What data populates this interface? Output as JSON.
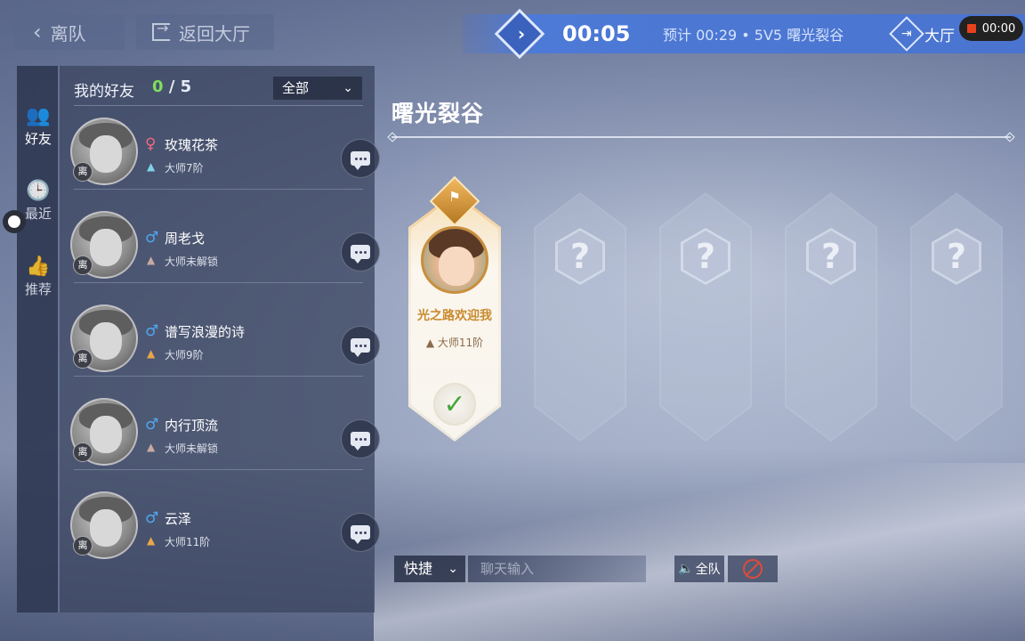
{
  "top": {
    "leave_label": "离队",
    "lobby_label": "返回大厅",
    "timer": "00:05",
    "estimate": "预计 00:29 • 5V5 曙光裂谷",
    "hall_label": "大厅",
    "recording_time": "00:00"
  },
  "side_tabs": [
    {
      "label": "好友",
      "icon": "friends-icon"
    },
    {
      "label": "最近",
      "icon": "clock-icon"
    },
    {
      "label": "推荐",
      "icon": "thumbs-up-icon"
    }
  ],
  "friends_panel": {
    "title": "我的好友",
    "online": "0",
    "total": "/ 5",
    "filter": "全部",
    "status_label": "离",
    "friends": [
      {
        "name": "玫瑰花茶",
        "gender": "female",
        "gender_symbol": "♀",
        "rank": "大师7阶"
      },
      {
        "name": "周老戈",
        "gender": "male",
        "gender_symbol": "♂",
        "rank": "大师未解锁"
      },
      {
        "name": "谱写浪漫的诗",
        "gender": "male",
        "gender_symbol": "♂",
        "rank": "大师9阶"
      },
      {
        "name": "内行顶流",
        "gender": "male",
        "gender_symbol": "♂",
        "rank": "大师未解锁"
      },
      {
        "name": "云泽",
        "gender": "male",
        "gender_symbol": "♂",
        "rank": "大师11阶"
      }
    ]
  },
  "room": {
    "mode_title": "曙光裂谷",
    "player": {
      "name": "光之路欢迎我",
      "rank": "大师11阶"
    },
    "empty_slot_mark": "?"
  },
  "chat": {
    "quick_label": "快捷",
    "placeholder": "聊天输入",
    "team_label": "全队"
  }
}
